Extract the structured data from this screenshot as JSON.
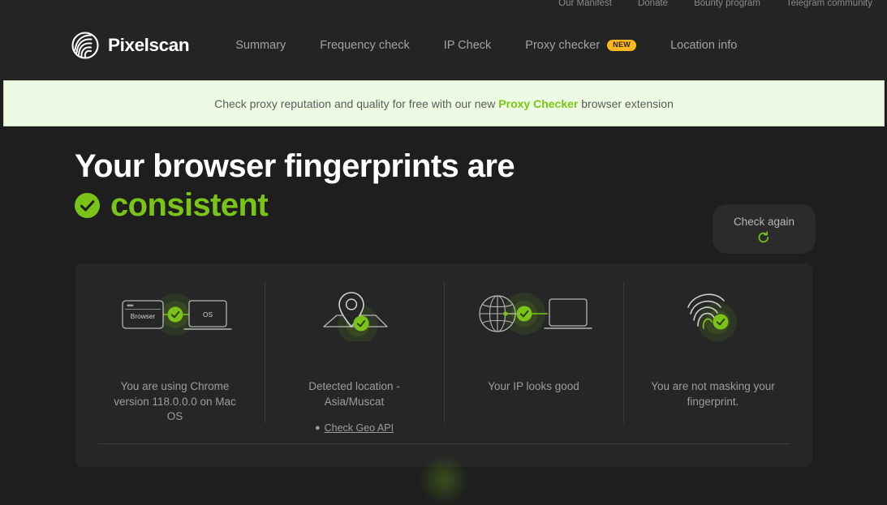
{
  "topbar": {
    "links": [
      {
        "label": "Our Manifest"
      },
      {
        "label": "Donate"
      },
      {
        "label": "Bounty program"
      },
      {
        "label": "Telegram community"
      }
    ]
  },
  "header": {
    "brand": "Pixelscan",
    "logo_icon": "pixelscan-spiral-logo",
    "nav": [
      {
        "label": "Summary",
        "badge": ""
      },
      {
        "label": "Frequency check",
        "badge": ""
      },
      {
        "label": "IP Check",
        "badge": ""
      },
      {
        "label": "Proxy checker",
        "badge": "NEW"
      },
      {
        "label": "Location info",
        "badge": ""
      }
    ]
  },
  "banner": {
    "text_before": "Check proxy reputation and quality for free with our new ",
    "link_label": "Proxy Checker",
    "text_after": " browser extension",
    "background_color": "#eefbe4",
    "link_color": "#7ac615"
  },
  "hero": {
    "title": "Your browser fingerprints are",
    "status_word": "consistent",
    "status_icon": "check-circle-icon",
    "status_color": "#7ac41a",
    "check_again": {
      "label": "Check again",
      "icon": "refresh-icon",
      "icon_color": "#7ac41a"
    }
  },
  "cards": [
    {
      "art_icon": "browser-to-os-icon",
      "art_labels": {
        "left": "Browser",
        "right": "OS"
      },
      "text": "You are using Chrome version 118.0.0.0 on Mac OS",
      "link": null
    },
    {
      "art_icon": "map-pin-location-icon",
      "text": "Detected location - Asia/Muscat",
      "link": {
        "label": "Check Geo API",
        "icon": "map-pin-icon"
      }
    },
    {
      "art_icon": "globe-to-laptop-icon",
      "text": "Your IP looks good",
      "link": null
    },
    {
      "art_icon": "fingerprint-icon",
      "text": "You are not masking your fingerprint.",
      "link": null
    }
  ],
  "colors": {
    "page_background": "#1e1e1e",
    "header_background": "#242424",
    "panel_background": "#262626",
    "accent_green": "#7ac41a",
    "badge_yellow": "#fcb91e"
  }
}
